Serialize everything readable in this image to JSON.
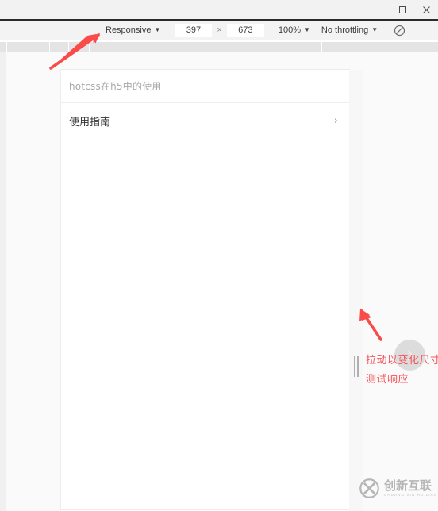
{
  "window": {
    "minimize_label": "minimize",
    "maximize_label": "maximize",
    "close_label": "close"
  },
  "device_toolbar": {
    "device_preset": "Responsive",
    "width_value": "397",
    "separator": "×",
    "height_value": "673",
    "zoom_value": "100%",
    "throttling_value": "No throttling",
    "offline_icon": "no-network-icon",
    "caret": "▼"
  },
  "ruler": {
    "tick_positions": [
      8,
      62,
      86,
      112,
      405,
      428,
      452
    ]
  },
  "page": {
    "card": {
      "header_text": "hotcss在h5中的使用",
      "rows": [
        {
          "label": "使用指南",
          "chevron": "›"
        }
      ]
    },
    "next_button_icon": "chevron-right-icon"
  },
  "annotations": {
    "resize_note": "拉动以变化尺寸测试响应",
    "arrow_top_name": "arrow-pointing-to-device-preset",
    "arrow_bottom_name": "arrow-pointing-to-drag-handle",
    "color": "#f5555a"
  },
  "watermark": {
    "brand_cn": "创新互联",
    "brand_pinyin": "CHUANG XIN HU LIAN",
    "logo_letter": "X"
  }
}
